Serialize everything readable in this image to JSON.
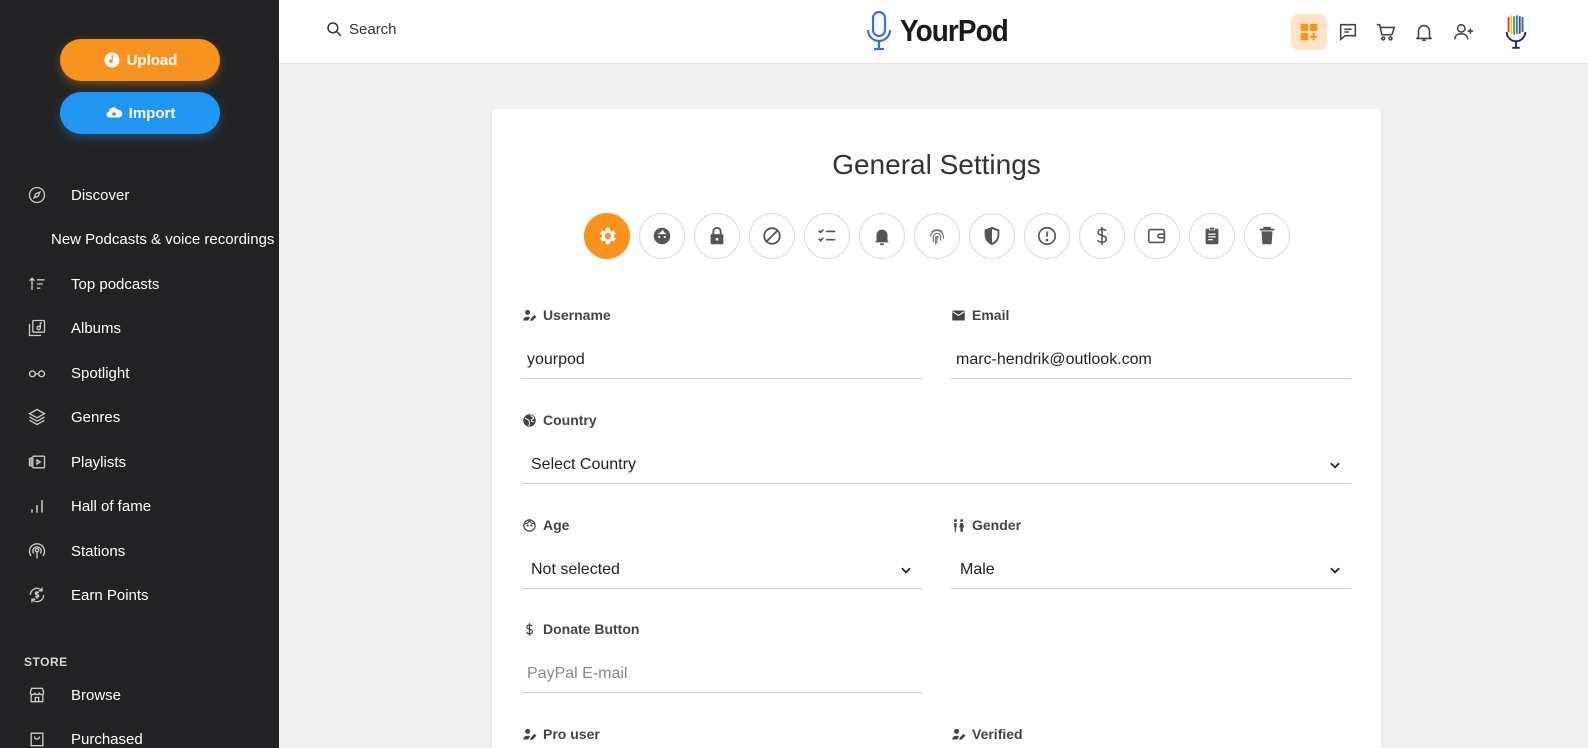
{
  "sidebar": {
    "upload_label": "Upload",
    "import_label": "Import",
    "items": [
      {
        "label": "Discover",
        "icon": "compass-icon"
      },
      {
        "label": "New Podcasts & voice recordings",
        "icon": ""
      },
      {
        "label": "Top podcasts",
        "icon": "sort-icon"
      },
      {
        "label": "Albums",
        "icon": "album-icon"
      },
      {
        "label": "Spotlight",
        "icon": "glasses-icon"
      },
      {
        "label": "Genres",
        "icon": "layers-icon"
      },
      {
        "label": "Playlists",
        "icon": "playlist-icon"
      },
      {
        "label": "Hall of fame",
        "icon": "bar-chart-icon"
      },
      {
        "label": "Stations",
        "icon": "broadcast-icon"
      },
      {
        "label": "Earn Points",
        "icon": "dollar-cycle-icon"
      }
    ],
    "store_heading": "STORE",
    "store_items": [
      {
        "label": "Browse",
        "icon": "store-icon"
      },
      {
        "label": "Purchased",
        "icon": "bag-icon"
      }
    ]
  },
  "header": {
    "search_label": "Search",
    "logo_text": "YourPod",
    "icons": [
      "dashboard-add-icon",
      "chat-icon",
      "cart-icon",
      "bell-icon",
      "add-user-icon",
      "avatar"
    ]
  },
  "settings": {
    "title": "General Settings",
    "tabs": [
      "gear-icon",
      "face-icon",
      "lock-icon",
      "block-icon",
      "checklist-icon",
      "bell-icon",
      "fingerprint-icon",
      "shield-icon",
      "alert-icon",
      "dollar-icon",
      "wallet-icon",
      "clipboard-icon",
      "trash-icon"
    ],
    "username_label": "Username",
    "username_value": "yourpod",
    "email_label": "Email",
    "email_value": "marc-hendrik@outlook.com",
    "country_label": "Country",
    "country_value": "Select Country",
    "age_label": "Age",
    "age_value": "Not selected",
    "gender_label": "Gender",
    "gender_value": "Male",
    "donate_label": "Donate Button",
    "donate_placeholder": "PayPal E-mail",
    "pro_label": "Pro user",
    "verified_label": "Verified"
  },
  "colors": {
    "accent_orange": "#f7931e",
    "accent_blue": "#2196f3",
    "sidebar_bg": "#222224"
  }
}
